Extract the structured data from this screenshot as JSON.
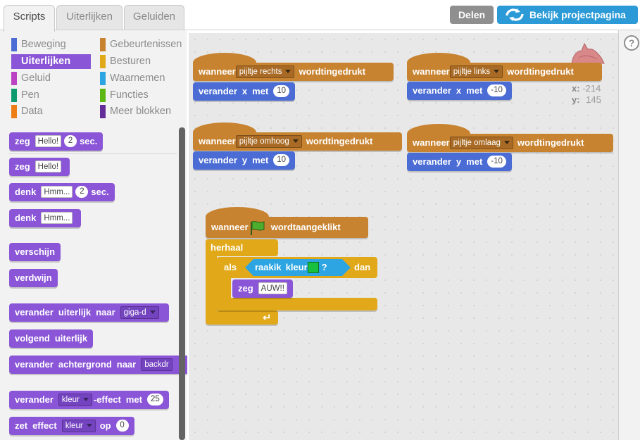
{
  "tabs": [
    {
      "label": "Scripts",
      "active": true
    },
    {
      "label": "Uiterlijken",
      "active": false
    },
    {
      "label": "Geluiden",
      "active": false
    }
  ],
  "header": {
    "share_label": "Delen",
    "project_page_label": "Bekijk projectpagina"
  },
  "categories": [
    {
      "label": "Beweging",
      "color": "#4a6cd4"
    },
    {
      "label": "Gebeurtenissen",
      "color": "#c88330"
    },
    {
      "label": "Uiterlijken",
      "color": "#8a55d7",
      "active": true
    },
    {
      "label": "Besturen",
      "color": "#e1a91a"
    },
    {
      "label": "Geluid",
      "color": "#bb42c3"
    },
    {
      "label": "Waarnemen",
      "color": "#2ca5e2"
    },
    {
      "label": "Pen",
      "color": "#0e9a6c"
    },
    {
      "label": "Functies",
      "color": "#5cb712"
    },
    {
      "label": "Data",
      "color": "#ee7d16"
    },
    {
      "label": "Meer blokken",
      "color": "#632d99"
    }
  ],
  "palette": {
    "say_secs": {
      "w1": "zeg",
      "text": "Hello!",
      "secs": "2",
      "w2": "sec."
    },
    "say": {
      "w1": "zeg",
      "text": "Hello!"
    },
    "think_secs": {
      "w1": "denk",
      "text": "Hmm...",
      "secs": "2",
      "w2": "sec."
    },
    "think": {
      "w1": "denk",
      "text": "Hmm..."
    },
    "show": "verschijn",
    "hide": "verdwijn",
    "switch_costume": {
      "w1": "verander",
      "w2": "uiterlijk",
      "w3": "naar",
      "value": "giga-d"
    },
    "next_costume": {
      "w1": "volgend",
      "w2": "uiterlijk"
    },
    "switch_backdrop": {
      "w1": "verander",
      "w2": "achtergrond",
      "w3": "naar",
      "value": "backdr"
    },
    "change_effect": {
      "w1": "verander",
      "value": "kleur",
      "w2": "-effect",
      "w3": "met",
      "num": "25"
    },
    "set_effect": {
      "w1": "zet",
      "w2": "effect",
      "value": "kleur",
      "w3": "op",
      "num": "0"
    }
  },
  "scripts": {
    "right": {
      "w1": "wanneer",
      "key": "pijltje rechts",
      "w2": "wordt",
      "w3": "ingedrukt",
      "m1": "verander",
      "axis": "x",
      "m2": "met",
      "val": "10"
    },
    "left": {
      "w1": "wanneer",
      "key": "pijltje links",
      "w2": "wordt",
      "w3": "ingedrukt",
      "m1": "verander",
      "axis": "x",
      "m2": "met",
      "val": "-10"
    },
    "up": {
      "w1": "wanneer",
      "key": "pijltje omhoog",
      "w2": "wordt",
      "w3": "ingedrukt",
      "m1": "verander",
      "axis": "y",
      "m2": "met",
      "val": "10"
    },
    "down": {
      "w1": "wanneer",
      "key": "pijltje omlaag",
      "w2": "wordt",
      "w3": "ingedrukt",
      "m1": "verander",
      "axis": "y",
      "m2": "met",
      "val": "-10"
    },
    "flag": {
      "w1": "wanneer",
      "w2": "wordt",
      "w3": "aangeklikt",
      "forever": "herhaal",
      "if": "als",
      "then": "dan",
      "touch": {
        "w1": "raak",
        "w2": "ik",
        "w3": "kleur",
        "q": "?",
        "color": "#18c13f"
      },
      "say": {
        "w1": "zeg",
        "text": "AUW!!"
      }
    }
  },
  "sprite_info": {
    "x_label": "x:",
    "x": "-214",
    "y_label": "y:",
    "y": "145"
  },
  "help": "?"
}
